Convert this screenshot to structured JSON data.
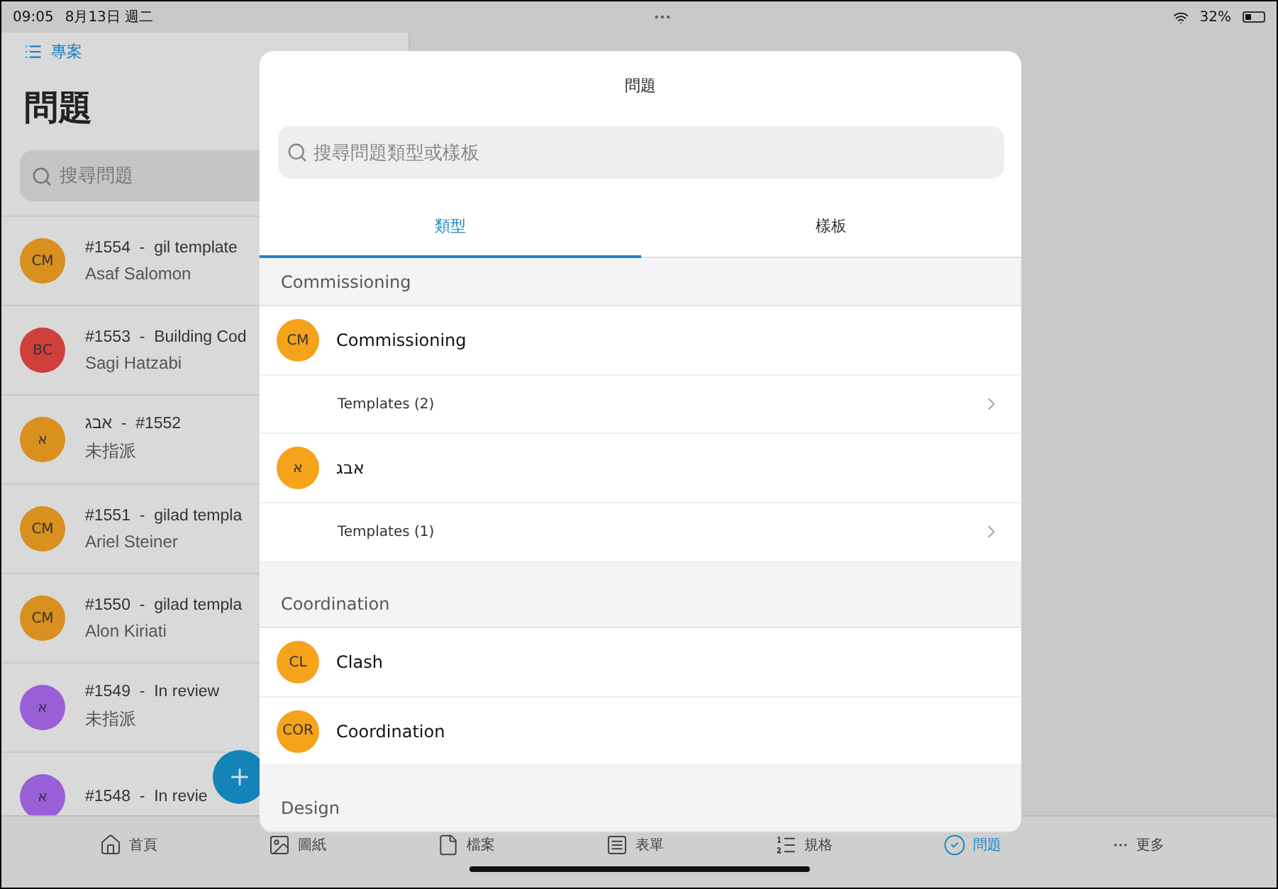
{
  "status_bar": {
    "time": "09:05",
    "date": "8月13日 週二",
    "battery": "32%"
  },
  "nav": {
    "back_label": "專案"
  },
  "page_title": "問題",
  "search": {
    "placeholder": "搜尋問題"
  },
  "issues": [
    {
      "avatar": "CM",
      "color": "#d8901e",
      "title": "#1554  -  gil template",
      "subtitle": "Asaf Salomon"
    },
    {
      "avatar": "BC",
      "color": "#cf3f3c",
      "title": "#1553  -  Building Cod",
      "subtitle": "Sagi Hatzabi"
    },
    {
      "avatar": "א",
      "color": "#d8901e",
      "title": "#1552  -  אבג",
      "subtitle": "未指派"
    },
    {
      "avatar": "CM",
      "color": "#d8901e",
      "title": "#1551  -  gilad templa",
      "subtitle": "Ariel Steiner"
    },
    {
      "avatar": "CM",
      "color": "#d8901e",
      "title": "#1550  -  gilad templa",
      "subtitle": "Alon Kiriati"
    },
    {
      "avatar": "א",
      "color": "#9a5ed6",
      "title": "#1549  -  In review",
      "subtitle": "未指派"
    },
    {
      "avatar": "א",
      "color": "#9a5ed6",
      "title": "#1548  -  In revie"
    }
  ],
  "tab_bar": [
    {
      "kind": "home",
      "label": "首頁",
      "selected": false
    },
    {
      "kind": "drawings",
      "label": "圖紙",
      "selected": false
    },
    {
      "kind": "files",
      "label": "檔案",
      "selected": false
    },
    {
      "kind": "forms",
      "label": "表單",
      "selected": false
    },
    {
      "kind": "specs",
      "label": "規格",
      "selected": false
    },
    {
      "kind": "issues",
      "label": "問題",
      "selected": true
    },
    {
      "kind": "more",
      "label": "更多",
      "selected": false
    }
  ],
  "dialog": {
    "title": "問題",
    "search": {
      "placeholder": "搜尋問題類型或樣板"
    },
    "tabs": [
      {
        "label": "類型",
        "selected": true
      },
      {
        "label": "樣板",
        "selected": false
      }
    ],
    "sections": [
      {
        "header": "Commissioning",
        "items": [
          {
            "kind": "type",
            "avatar": "CM",
            "label": "Commissioning"
          },
          {
            "kind": "templates",
            "label": "Templates (2)"
          },
          {
            "kind": "type",
            "avatar": "א",
            "label": "אבג"
          },
          {
            "kind": "templates",
            "label": "Templates (1)"
          }
        ]
      },
      {
        "header": "Coordination",
        "items": [
          {
            "kind": "type",
            "avatar": "CL",
            "label": "Clash"
          },
          {
            "kind": "type",
            "avatar": "COR",
            "label": "Coordination"
          }
        ]
      },
      {
        "header": "Design"
      }
    ]
  }
}
